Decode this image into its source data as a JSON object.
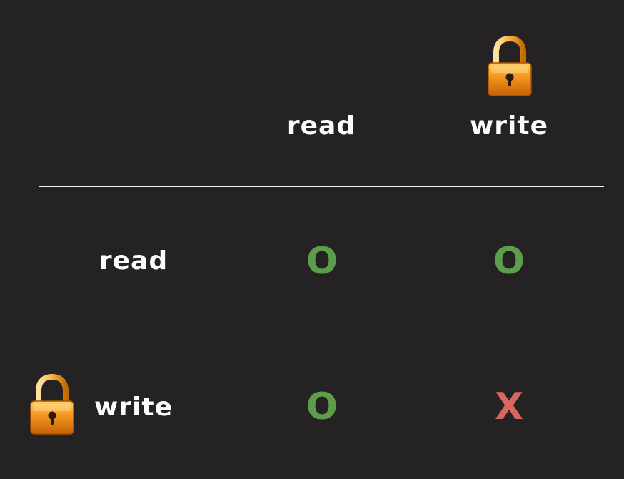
{
  "matrix": {
    "column_headers": [
      {
        "label": "read",
        "locked": false
      },
      {
        "label": "write",
        "locked": true
      }
    ],
    "row_headers": [
      {
        "label": "read",
        "locked": false
      },
      {
        "label": "write",
        "locked": true
      }
    ],
    "cells": [
      [
        "O",
        "O"
      ],
      [
        "O",
        "X"
      ]
    ]
  },
  "icons": {
    "lock": "lock-icon"
  },
  "colors": {
    "background": "#242223",
    "allowed": "#5e9d49",
    "denied": "#d9675e",
    "lock_body": "#f59a22"
  }
}
